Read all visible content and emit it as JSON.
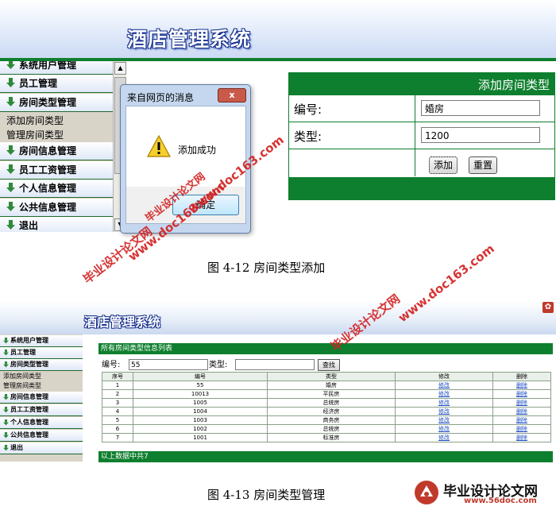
{
  "top_screenshot": {
    "app_title": "酒店管理系统",
    "sidebar": {
      "items": [
        {
          "label": "系统用户管理"
        },
        {
          "label": "员工管理"
        },
        {
          "label": "房间类型管理"
        },
        {
          "label": "房间信息管理"
        },
        {
          "label": "员工工资管理"
        },
        {
          "label": "个人信息管理"
        },
        {
          "label": "公共信息管理"
        },
        {
          "label": "退出"
        }
      ],
      "sub_items": [
        "添加房间类型",
        "管理房间类型"
      ]
    },
    "dialog": {
      "title": "来自网页的消息",
      "message": "添加成功",
      "ok_label": "确定",
      "close_label": "x"
    },
    "form": {
      "header": "添加房间类型",
      "fields": [
        {
          "label": "编号:",
          "value": "婚房"
        },
        {
          "label": "类型:",
          "value": "1200"
        }
      ],
      "add_label": "添加",
      "reset_label": "重置"
    }
  },
  "caption1": "图 4-12  房间类型添加",
  "bottom_screenshot": {
    "app_title": "酒店管理系统",
    "sidebar": {
      "items": [
        "系统用户管理",
        "员工管理",
        "房间类型管理",
        "房间信息管理",
        "员工工资管理",
        "个人信息管理",
        "公共信息管理",
        "退出"
      ],
      "sub_items": [
        "添加房间类型",
        "管理房间类型"
      ]
    },
    "list_header": "所有房间类型信息列表",
    "search": {
      "id_label": "编号:",
      "id_value": "55",
      "type_label": "类型:",
      "type_value": "",
      "button": "查找"
    },
    "table": {
      "columns": [
        "序号",
        "编号",
        "类型",
        "修改",
        "删除"
      ],
      "rows": [
        [
          "1",
          "55",
          "婚房",
          "修改",
          "删除"
        ],
        [
          "2",
          "10013",
          "平民房",
          "修改",
          "删除"
        ],
        [
          "3",
          "1005",
          "总统房",
          "修改",
          "删除"
        ],
        [
          "4",
          "1004",
          "经济房",
          "修改",
          "删除"
        ],
        [
          "5",
          "1003",
          "商务房",
          "修改",
          "删除"
        ],
        [
          "6",
          "1002",
          "总统房",
          "修改",
          "删除"
        ],
        [
          "7",
          "1001",
          "标准房",
          "修改",
          "删除"
        ]
      ]
    },
    "footer": "以上数据中共7"
  },
  "caption2": "图 4-13  房间类型管理",
  "watermarks": [
    "毕业设计论文网",
    "www.doc163.com",
    "www.doc163.com",
    "毕业设计论文网",
    "www.doc163.com",
    "毕业设计论文网"
  ],
  "bottom_logo": {
    "text": "毕业设计论文网",
    "url": "www.56doc.com"
  },
  "colors": {
    "green": "#0e7f2e",
    "watermark_red": "#d32323",
    "title_blue": "#17318c"
  }
}
